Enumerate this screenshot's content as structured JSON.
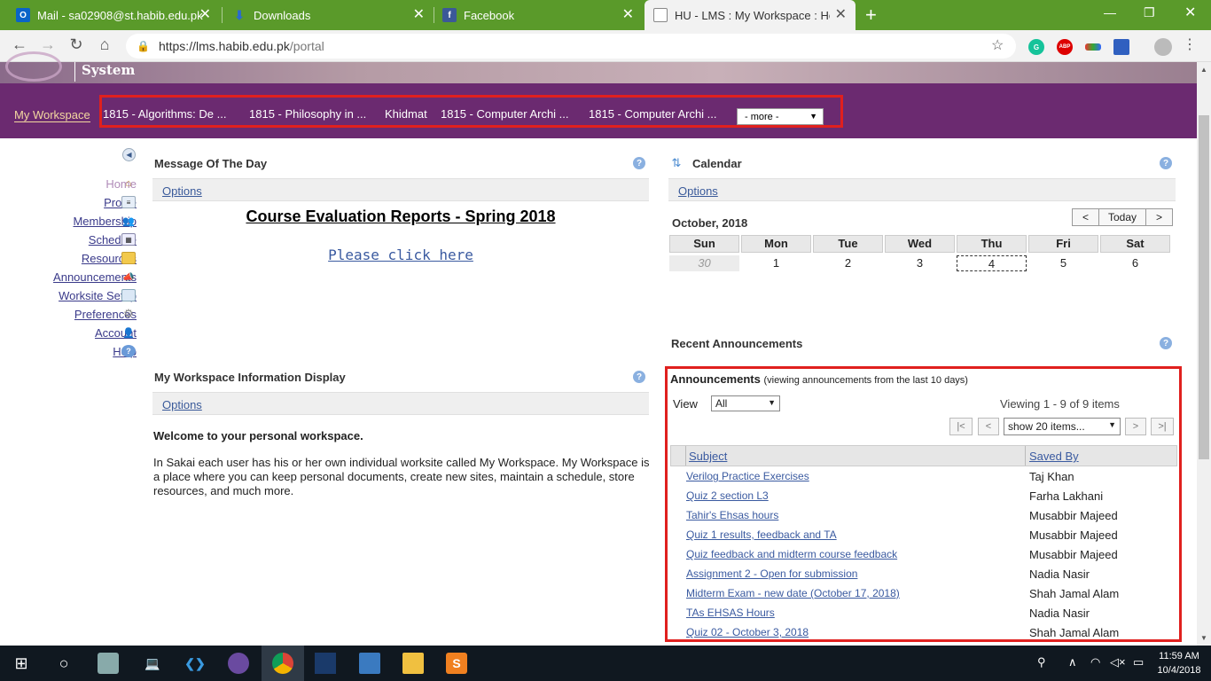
{
  "browser": {
    "tabs": [
      {
        "title": "Mail - sa02908@st.habib.edu.pk",
        "icon": "outlook-icon"
      },
      {
        "title": "Downloads",
        "icon": "download-icon"
      },
      {
        "title": "Facebook",
        "icon": "facebook-icon"
      },
      {
        "title": "HU - LMS : My Workspace : Hom",
        "icon": "page-icon"
      }
    ],
    "new_tab": "+",
    "url_host": "https://lms.habib.edu.pk",
    "url_path": "/portal",
    "extensions": [
      "grammarly-icon",
      "adblock-icon",
      "rainbow-icon",
      "flag-icon",
      "profile-icon"
    ],
    "ext_labels": {
      "grammarly": "G",
      "adblock": "ABP"
    },
    "accent": "#5a9a2a"
  },
  "site": {
    "system_word": "System",
    "my_workspace": "My Workspace",
    "site_tabs": [
      "1815 - Algorithms: De ...",
      "1815 - Philosophy in ...",
      "Khidmat",
      "1815 - Computer Archi ...",
      "1815 - Computer Archi ..."
    ],
    "more_select": "- more -",
    "header_color": "#6b2a70"
  },
  "tools": [
    {
      "label": "Home",
      "icon": "home-icon"
    },
    {
      "label": "Profile",
      "icon": "profile-card-icon"
    },
    {
      "label": "Membership",
      "icon": "members-icon"
    },
    {
      "label": "Schedule",
      "icon": "calendar-grid-icon"
    },
    {
      "label": "Resources",
      "icon": "folder-icon"
    },
    {
      "label": "Announcements",
      "icon": "megaphone-icon"
    },
    {
      "label": "Worksite Setup",
      "icon": "worksite-icon"
    },
    {
      "label": "Preferences",
      "icon": "gear-icon"
    },
    {
      "label": "Account",
      "icon": "user-icon"
    },
    {
      "label": "Help",
      "icon": "help-icon"
    }
  ],
  "motd": {
    "title": "Message Of The Day",
    "options": "Options",
    "heading": "Course Evaluation Reports - Spring 2018",
    "link": "Please click here"
  },
  "workspace_info": {
    "title": "My Workspace Information Display",
    "options": "Options",
    "welcome": "Welcome to your personal workspace.",
    "body": "In Sakai each user has his or her own individual worksite called My Workspace. My Workspace is a place where you can keep personal documents, create new sites, maintain a schedule, store resources, and much more."
  },
  "calendar": {
    "title": "Calendar",
    "options": "Options",
    "month": "October, 2018",
    "prev": "<",
    "today": "Today",
    "next": ">",
    "weekdays": [
      "Sun",
      "Mon",
      "Tue",
      "Wed",
      "Thu",
      "Fri",
      "Sat"
    ],
    "days": [
      "30",
      "1",
      "2",
      "3",
      "4",
      "5",
      "6"
    ]
  },
  "recent_announcements": {
    "title": "Recent Announcements",
    "heading": "Announcements",
    "subheading": "(viewing announcements from the last 10 days)",
    "view_label": "View",
    "view_value": "All",
    "viewing": "Viewing 1 - 9 of 9 items",
    "page_size": "show 20 items...",
    "pager": {
      "first": "|<",
      "prev": "<",
      "next": ">",
      "last": ">|"
    },
    "columns": [
      "Subject",
      "Saved By"
    ],
    "rows": [
      {
        "subject": "Verilog Practice Exercises",
        "saved_by": "Taj Khan"
      },
      {
        "subject": "Quiz 2 section L3",
        "saved_by": "Farha Lakhani"
      },
      {
        "subject": "Tahir's Ehsas hours",
        "saved_by": "Musabbir Majeed"
      },
      {
        "subject": "Quiz 1 results, feedback and TA",
        "saved_by": "Musabbir Majeed"
      },
      {
        "subject": "Quiz feedback and midterm course feedback",
        "saved_by": "Musabbir Majeed"
      },
      {
        "subject": "Assignment 2 - Open for submission",
        "saved_by": "Nadia Nasir"
      },
      {
        "subject": "Midterm Exam - new date (October 17, 2018)",
        "saved_by": "Shah Jamal Alam"
      },
      {
        "subject": "TAs EHSAS Hours",
        "saved_by": "Nadia Nasir"
      },
      {
        "subject": "Quiz 02 - October 3, 2018",
        "saved_by": "Shah Jamal Alam"
      }
    ]
  },
  "taskbar": {
    "time": "11:59 AM",
    "date": "10/4/2018",
    "apps": [
      "windows-start-icon",
      "cortana-icon",
      "file-manager-icon",
      "laptop-icon",
      "vscode-icon",
      "github-icon",
      "chrome-icon",
      "inkscape-icon",
      "photos-icon",
      "explorer-icon",
      "sublime-icon"
    ]
  }
}
